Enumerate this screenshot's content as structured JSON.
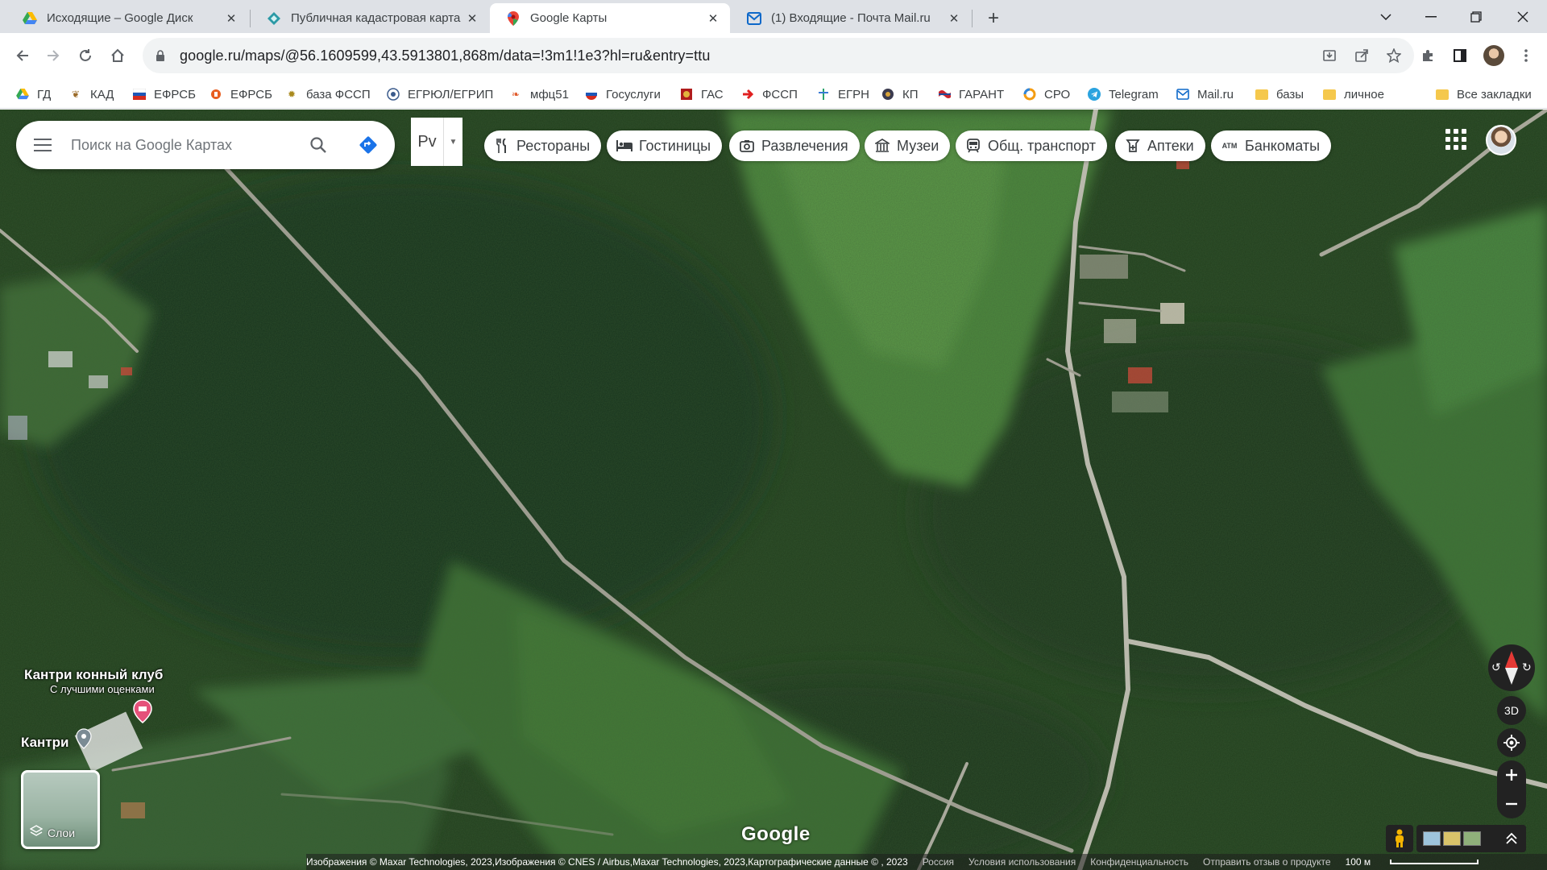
{
  "browser": {
    "tabs": [
      {
        "title": "Исходящие – Google Диск",
        "active": false
      },
      {
        "title": "Публичная кадастровая карта",
        "active": false
      },
      {
        "title": "Google Карты",
        "active": true
      },
      {
        "title": "(1) Входящие - Почта Mail.ru",
        "active": false
      }
    ],
    "url": "google.ru/maps/@56.1609599,43.5913801,868m/data=!3m1!1e3?hl=ru&entry=ttu",
    "bookmarks": [
      {
        "label": "ГД",
        "icon": "google-drive-icon"
      },
      {
        "label": "КАД",
        "icon": "emblem-icon"
      },
      {
        "label": "ЕФРСБ",
        "icon": "flag-icon"
      },
      {
        "label": "ЕФРСБ",
        "icon": "orange-logo-icon"
      },
      {
        "label": "база ФССП",
        "icon": "emblem-icon"
      },
      {
        "label": "ЕГРЮЛ/ЕГРИП",
        "icon": "seal-icon"
      },
      {
        "label": "мфц51",
        "icon": "leaf-icon"
      },
      {
        "label": "Госуслуги",
        "icon": "russia-flag-icon"
      },
      {
        "label": "ГАС",
        "icon": "emblem-icon"
      },
      {
        "label": "ФССП",
        "icon": "red-arrow-icon"
      },
      {
        "label": "ЕГРН",
        "icon": "rosreestr-icon"
      },
      {
        "label": "КП",
        "icon": "kp-icon"
      },
      {
        "label": "ГАРАНТ",
        "icon": "garant-icon"
      },
      {
        "label": "СРО",
        "icon": "sro-icon"
      },
      {
        "label": "Telegram",
        "icon": "telegram-icon"
      },
      {
        "label": "Mail.ru",
        "icon": "mail-icon"
      },
      {
        "label": "базы",
        "icon": "folder-icon"
      },
      {
        "label": "личное",
        "icon": "folder-icon"
      }
    ],
    "all_bookmarks": "Все закладки"
  },
  "maps": {
    "search_placeholder": "Поиск на Google Картах",
    "language": "Рv",
    "chips": [
      {
        "label": "Рестораны",
        "icon": "restaurant-icon"
      },
      {
        "label": "Гостиницы",
        "icon": "hotel-icon"
      },
      {
        "label": "Развлечения",
        "icon": "camera-icon"
      },
      {
        "label": "Музеи",
        "icon": "museum-icon"
      },
      {
        "label": "Общ. транспорт",
        "icon": "transit-icon"
      },
      {
        "label": "Аптеки",
        "icon": "pharmacy-icon"
      },
      {
        "label": "Банкоматы",
        "icon": "atm-icon"
      }
    ],
    "place_name": "Кантри конный клуб",
    "place_sub": "С лучшими оценками",
    "place_short": "Кантри",
    "layers_label": "Слои",
    "logo": "Google",
    "btn_3d": "3D",
    "attribution": "Изображения © Maxar Technologies, 2023,Изображения © CNES / Airbus,Maxar Technologies, 2023,Картографические данные © , 2023",
    "footer_links": [
      "Россия",
      "Условия использования",
      "Конфиденциальность",
      "Отправить отзыв о продукте"
    ],
    "scale": "100 м"
  },
  "colors": {
    "forest_dark": "#1f3a1c",
    "field_green": "#4f8a3c",
    "road": "#b9b9a8",
    "accent_blue": "#1a73e8"
  }
}
